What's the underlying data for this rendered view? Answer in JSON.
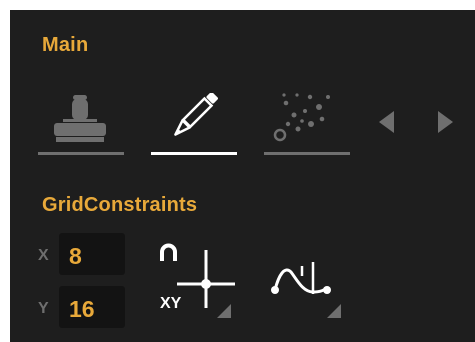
{
  "sections": {
    "main_title": "Main",
    "grid_title": "GridConstraints"
  },
  "tools": [
    {
      "icon": "stamp-icon",
      "active": false
    },
    {
      "icon": "pencil-icon",
      "active": true
    },
    {
      "icon": "scatter-spray-icon",
      "active": false
    }
  ],
  "nav": {
    "prev_icon": "triangle-left-icon",
    "next_icon": "triangle-right-icon"
  },
  "grid": {
    "x_label": "X",
    "x_value": "8",
    "y_label": "Y",
    "y_value": "16",
    "snap_button": {
      "icon": "magnet-crosshair-icon",
      "label": "XY"
    },
    "curve_button": {
      "icon": "curve-constraint-icon"
    }
  },
  "colors": {
    "panel_bg": "#1e1e1e",
    "accent": "#e8a93a",
    "field_bg": "#131313",
    "muted": "#6f6f6f",
    "white": "#ffffff"
  }
}
